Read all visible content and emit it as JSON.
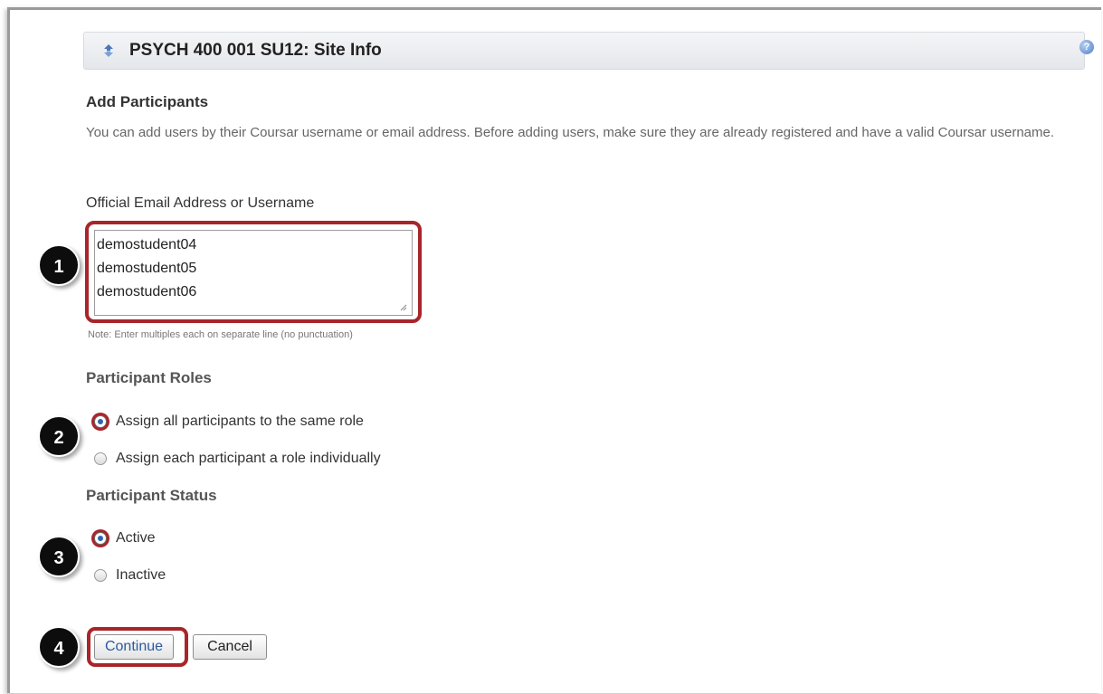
{
  "header": {
    "title": "PSYCH 400 001 SU12: Site Info",
    "help_symbol": "?"
  },
  "form": {
    "heading": "Add Participants",
    "instructions": "You can add users by their Coursar username or email address. Before adding users, make sure they are already registered and have a valid Coursar username.",
    "field_label": "Official Email Address or Username",
    "field_value": "demostudent04\ndemostudent05\ndemostudent06",
    "note": "Note: Enter multiples each on separate line (no punctuation)",
    "roles_label": "Participant Roles",
    "role_options": [
      "Assign all participants to the same role",
      "Assign each participant a role individually"
    ],
    "role_selected": 0,
    "status_label": "Participant Status",
    "status_options": [
      "Active",
      "Inactive"
    ],
    "status_selected": 0,
    "continue_label": "Continue",
    "cancel_label": "Cancel"
  },
  "callouts": [
    "1",
    "2",
    "3",
    "4"
  ],
  "colors": {
    "highlight": "#a8252a",
    "badge": "#0d0d0d",
    "link_blue": "#2c5aa0"
  }
}
